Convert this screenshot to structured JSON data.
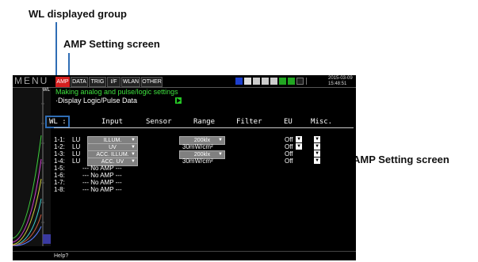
{
  "annotations": {
    "wl_group": "WL displayed group",
    "amp_top": "AMP Setting screen",
    "amp_right": "AMP Setting screen"
  },
  "screen": {
    "menu_label": "MENU",
    "tabs": [
      {
        "label": "AMP",
        "active": true
      },
      {
        "label": "DATA",
        "active": false
      },
      {
        "label": "TRIG",
        "active": false
      },
      {
        "label": "I/F",
        "active": false
      },
      {
        "label": "WLAN",
        "active": false
      },
      {
        "label": "OTHER",
        "active": false
      }
    ],
    "date": "2015-03-09",
    "time": "15:48:51",
    "wl_side": "WL",
    "status_message": "Making analog and pulse/logic settings",
    "display_logic": "·Display Logic/Pulse Data",
    "headers": {
      "wl": "WL :",
      "input": "Input",
      "sensor": "Sensor",
      "range": "Range",
      "filter": "Filter",
      "eu": "EU",
      "misc": "Misc."
    },
    "rows": [
      {
        "id": "1-1:",
        "grp": "LU",
        "input": "ILLUM.",
        "range": "200klx",
        "eu": "Off"
      },
      {
        "id": "1-2:",
        "grp": "LU",
        "input": "UV",
        "range": "30mW/cm²",
        "eu": "Off"
      },
      {
        "id": "1-3:",
        "grp": "LU",
        "input": "ACC. ILLUM.",
        "range": "200klx",
        "eu": "Off"
      },
      {
        "id": "1-4:",
        "grp": "LU",
        "input": "ACC. UV",
        "range": "30mW/cm²",
        "eu": "Off"
      },
      {
        "id": "1-5:",
        "no_amp": "--- No AMP ---"
      },
      {
        "id": "1-6:",
        "no_amp": "--- No AMP ---"
      },
      {
        "id": "1-7:",
        "no_amp": "--- No AMP ---"
      },
      {
        "id": "1-8:",
        "no_amp": "--- No AMP ---"
      }
    ],
    "help": "Help?"
  },
  "colors": {
    "annotation_line": "#2f6db5",
    "active_tab": "#d41f1f",
    "status_text": "#3ee03e"
  }
}
